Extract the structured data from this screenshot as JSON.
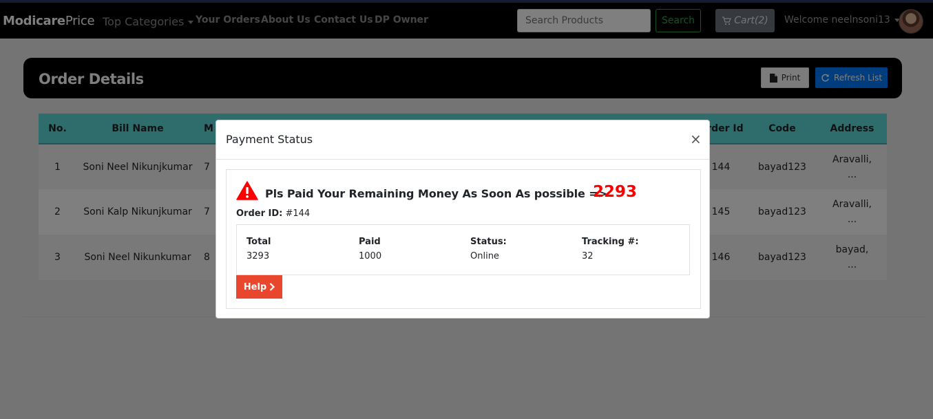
{
  "navbar": {
    "brand_bold": "Modicare",
    "brand_light": "Price",
    "dropdown_label": "Top Categories",
    "links": [
      "Your Orders",
      "About Us",
      "Contact Us",
      "DP Owner"
    ],
    "search_placeholder": "Search Products",
    "search_button": "Search",
    "cart_label": "Cart(2)",
    "welcome": "Welcome neelnsoni13"
  },
  "page": {
    "title": "Order Details",
    "print_label": "Print",
    "refresh_label": "Refresh List"
  },
  "table": {
    "columns": [
      "No.",
      "Bill Name",
      "M",
      "Order Id",
      "Code",
      "Address"
    ],
    "rows": [
      {
        "no": "1",
        "bill_name": "Soni Neel Nikunjkumar",
        "mobile": "7",
        "order_id": "144",
        "code": "bayad123",
        "address_1": "Aravalli,",
        "address_2": "..."
      },
      {
        "no": "2",
        "bill_name": "Soni Kalp Nikunjkumar",
        "mobile": "7",
        "order_id": "145",
        "code": "bayad123",
        "address_1": "Aravalli,",
        "address_2": "..."
      },
      {
        "no": "3",
        "bill_name": "Soni Neel Nikunkumar",
        "mobile": "8",
        "order_id": "146",
        "code": "bayad123",
        "address_1": "bayad,",
        "address_2": "..."
      }
    ]
  },
  "modal": {
    "title": "Payment Status",
    "close": "×",
    "message": "Pls Paid Your Remaining Money As Soon As possible =>",
    "remaining": "2293",
    "order_label": "Order ID:",
    "order_value": "#144",
    "total_label": "Total",
    "total_value": "3293",
    "paid_label": "Paid",
    "paid_value": "1000",
    "status_label": "Status:",
    "status_value": "Online",
    "tracking_label": "Tracking #:",
    "tracking_value": "32",
    "help_label": "Help"
  },
  "colors": {
    "navbar": "#000000",
    "table_header": "#5fd8d9",
    "search_green": "#28a745",
    "refresh_blue": "#007bff",
    "help_orange": "#e8472e",
    "remaining_red": "#ff0000",
    "warning_red": "#ff0000"
  },
  "icons": [
    "chevron-down-icon",
    "cart-icon",
    "file-icon",
    "refresh-icon",
    "warning-icon",
    "chevron-right-icon",
    "close-icon"
  ]
}
